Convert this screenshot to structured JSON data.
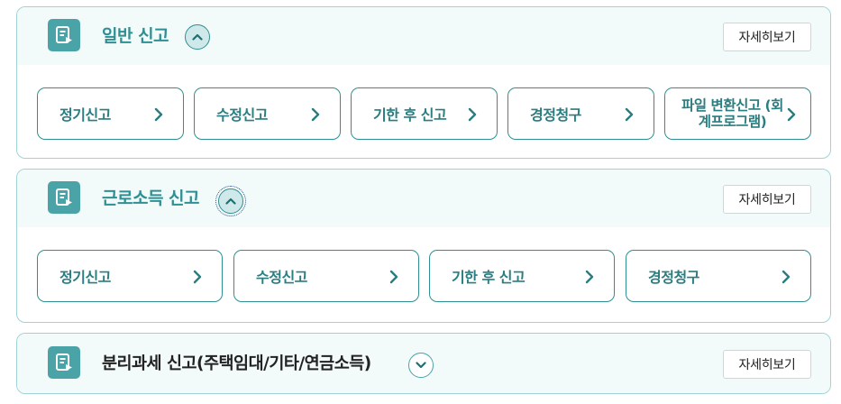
{
  "sections": [
    {
      "title": "일반 신고",
      "more_label": "자세히보기",
      "toggle_icon": "chevron-up-icon",
      "options": [
        {
          "label": "정기신고"
        },
        {
          "label": "수정신고"
        },
        {
          "label": "기한 후 신고"
        },
        {
          "label": "경정청구"
        },
        {
          "label": "파일 변환신고 (회계프로그램)"
        }
      ]
    },
    {
      "title": "근로소득 신고",
      "more_label": "자세히보기",
      "toggle_icon": "chevron-up-icon",
      "options": [
        {
          "label": "정기신고"
        },
        {
          "label": "수정신고"
        },
        {
          "label": "기한 후 신고"
        },
        {
          "label": "경정청구"
        }
      ]
    },
    {
      "title": "분리과세 신고(주택임대/기타/연금소득)",
      "more_label": "자세히보기",
      "toggle_icon": "chevron-down-icon",
      "options": []
    }
  ],
  "colors": {
    "teal": "#2f8f92",
    "teal_icon_bg": "#4aa3a6",
    "border": "#9fd3d6",
    "header_bg": "#f2fafa"
  }
}
